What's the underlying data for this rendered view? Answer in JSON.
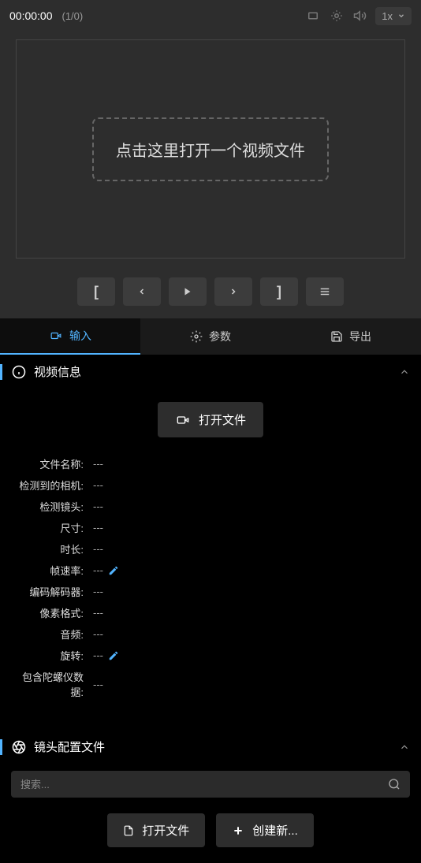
{
  "preview": {
    "timecode": "00:00:00",
    "frameCount": "(1/0)",
    "speed": "1x",
    "dropText": "点击这里打开一个视频文件"
  },
  "controls": {
    "markIn": "[",
    "markOut": "]"
  },
  "tabs": {
    "input": "输入",
    "params": "参数",
    "export": "导出"
  },
  "videoInfo": {
    "title": "视频信息",
    "openFile": "打开文件",
    "rows": [
      {
        "label": "文件名称:",
        "value": "---"
      },
      {
        "label": "检测到的相机:",
        "value": "---"
      },
      {
        "label": "检测镜头:",
        "value": "---"
      },
      {
        "label": "尺寸:",
        "value": "---"
      },
      {
        "label": "时长:",
        "value": "---"
      },
      {
        "label": "帧速率:",
        "value": "---",
        "editable": true
      },
      {
        "label": "编码解码器:",
        "value": "---"
      },
      {
        "label": "像素格式:",
        "value": "---"
      },
      {
        "label": "音频:",
        "value": "---"
      },
      {
        "label": "旋转:",
        "value": "---",
        "editable": true
      },
      {
        "label": "包含陀螺仪数据:",
        "value": "---"
      }
    ]
  },
  "lensProfile": {
    "title": "镜头配置文件",
    "searchPlaceholder": "搜索...",
    "openFile": "打开文件",
    "createNew": "创建新..."
  }
}
